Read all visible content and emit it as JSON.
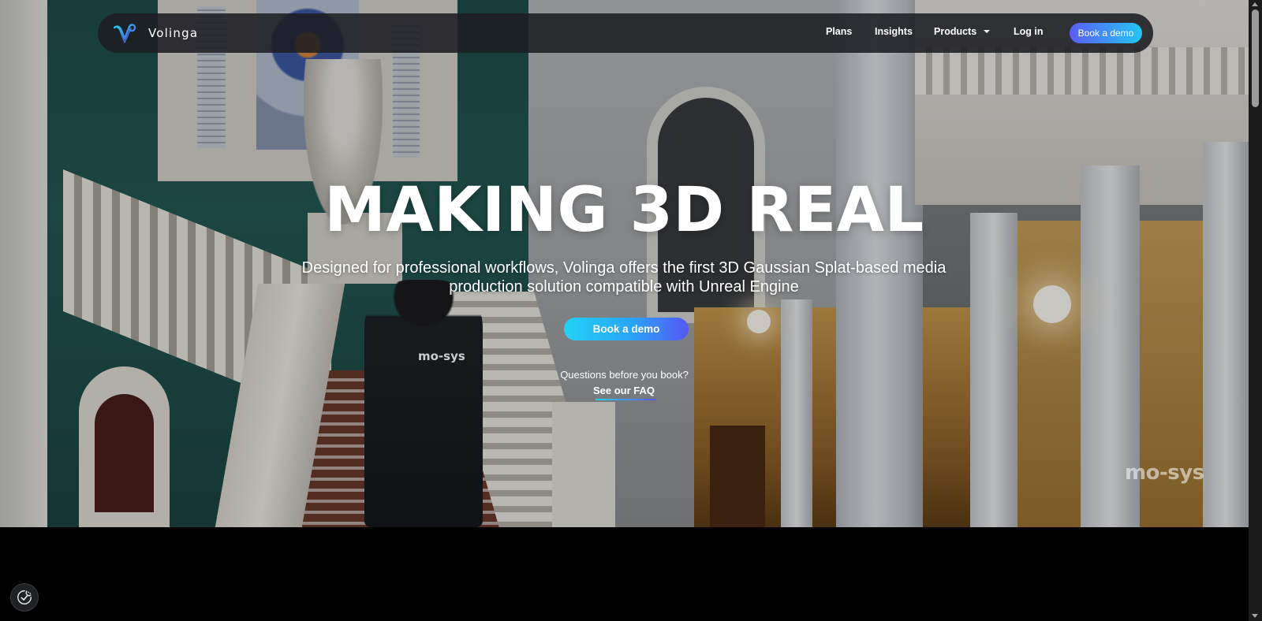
{
  "brand": {
    "name": "Volinga",
    "icon": "volinga-logo-icon"
  },
  "nav": {
    "plans": "Plans",
    "insights": "Insights",
    "products": "Products",
    "products_icon": "chevron-down-icon",
    "login": "Log in",
    "cta": "Book a demo"
  },
  "hero": {
    "title": "MAKING 3D REAL",
    "subtitle": "Designed for professional workflows, Volinga offers the first 3D Gaussian Splat-based media production solution compatible with Unreal Engine",
    "cta": "Book a demo",
    "questions": "Questions before you book?",
    "faq": "See our FAQ",
    "watermark": "mo-sys",
    "shirt_logo": "mo-sys"
  },
  "cookie": {
    "icon": "cookie-consent-icon"
  },
  "colors": {
    "nav_bg": "#1c1e22",
    "accent_cyan": "#23d3f5",
    "accent_violet": "#5558f5",
    "page_bg": "#000000"
  }
}
